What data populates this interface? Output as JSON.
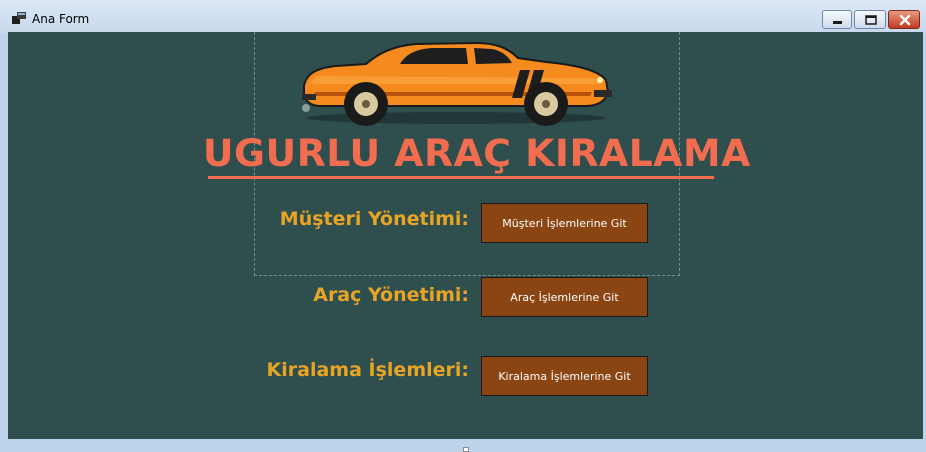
{
  "window": {
    "title": "Ana Form"
  },
  "header": {
    "brand": "UGURLU ARAÇ KIRALAMA"
  },
  "sections": [
    {
      "label": "Müşteri Yönetimi:",
      "button": "Müşteri İşlemlerine Git"
    },
    {
      "label": "Araç Yönetimi:",
      "button": "Araç İşlemlerine Git"
    },
    {
      "label": "Kiralama İşlemleri:",
      "button": "Kiralama İşlemlerine Git"
    }
  ],
  "colors": {
    "background": "#2f4f4f",
    "brand": "#f26c4f",
    "label": "#e8a424",
    "button": "#8b4513"
  },
  "icons": {
    "app": "form-icon",
    "car": "car-icon",
    "minimize": "minimize-icon",
    "maximize": "maximize-icon",
    "close": "close-icon"
  }
}
